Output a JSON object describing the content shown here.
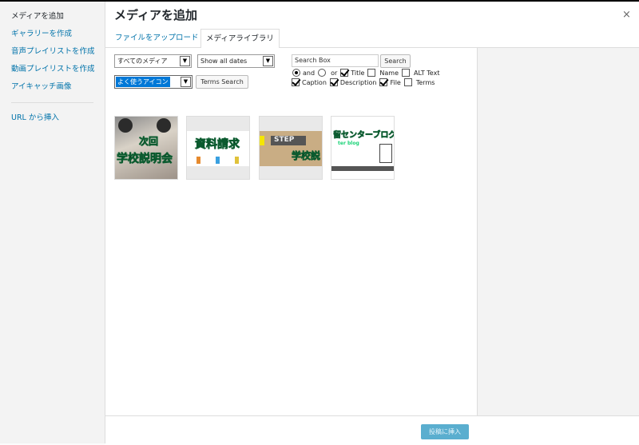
{
  "menu": {
    "items": [
      {
        "label": "メディアを追加"
      },
      {
        "label": "ギャラリーを作成"
      },
      {
        "label": "音声プレイリストを作成"
      },
      {
        "label": "動画プレイリストを作成"
      },
      {
        "label": "アイキャッチ画像"
      }
    ],
    "url_insert": "URL から挿入"
  },
  "header": {
    "title": "メディアを追加",
    "close": "×"
  },
  "tabs": [
    {
      "label": "ファイルをアップロード"
    },
    {
      "label": "メディアライブラリ"
    }
  ],
  "filters": {
    "media_type": "すべてのメディア",
    "dates": "Show all dates",
    "term": "よく使うアイコン",
    "terms_search_label": "Terms Search",
    "search_placeholder": "Search Box",
    "search_label": "Search",
    "and_label": "and",
    "or_label": "or",
    "title_label": "Title",
    "name_label": "Name",
    "alt_label": "ALT Text",
    "caption_label": "Caption",
    "description_label": "Description",
    "file_label": "File",
    "terms_label": "Terms"
  },
  "thumbnails": [
    {
      "line1": "次回",
      "line2": "学校説明会"
    },
    {
      "line1": "資料請求"
    },
    {
      "line1": "STEP",
      "line2": "学校説"
    },
    {
      "line1": "留センターブログ",
      "line2": "ter blog"
    }
  ],
  "footer": {
    "insert_label": "投稿に挿入"
  },
  "colors": {
    "link": "#0073aa",
    "primary_button": "#5aaecf",
    "select_highlight": "#0078d7"
  }
}
